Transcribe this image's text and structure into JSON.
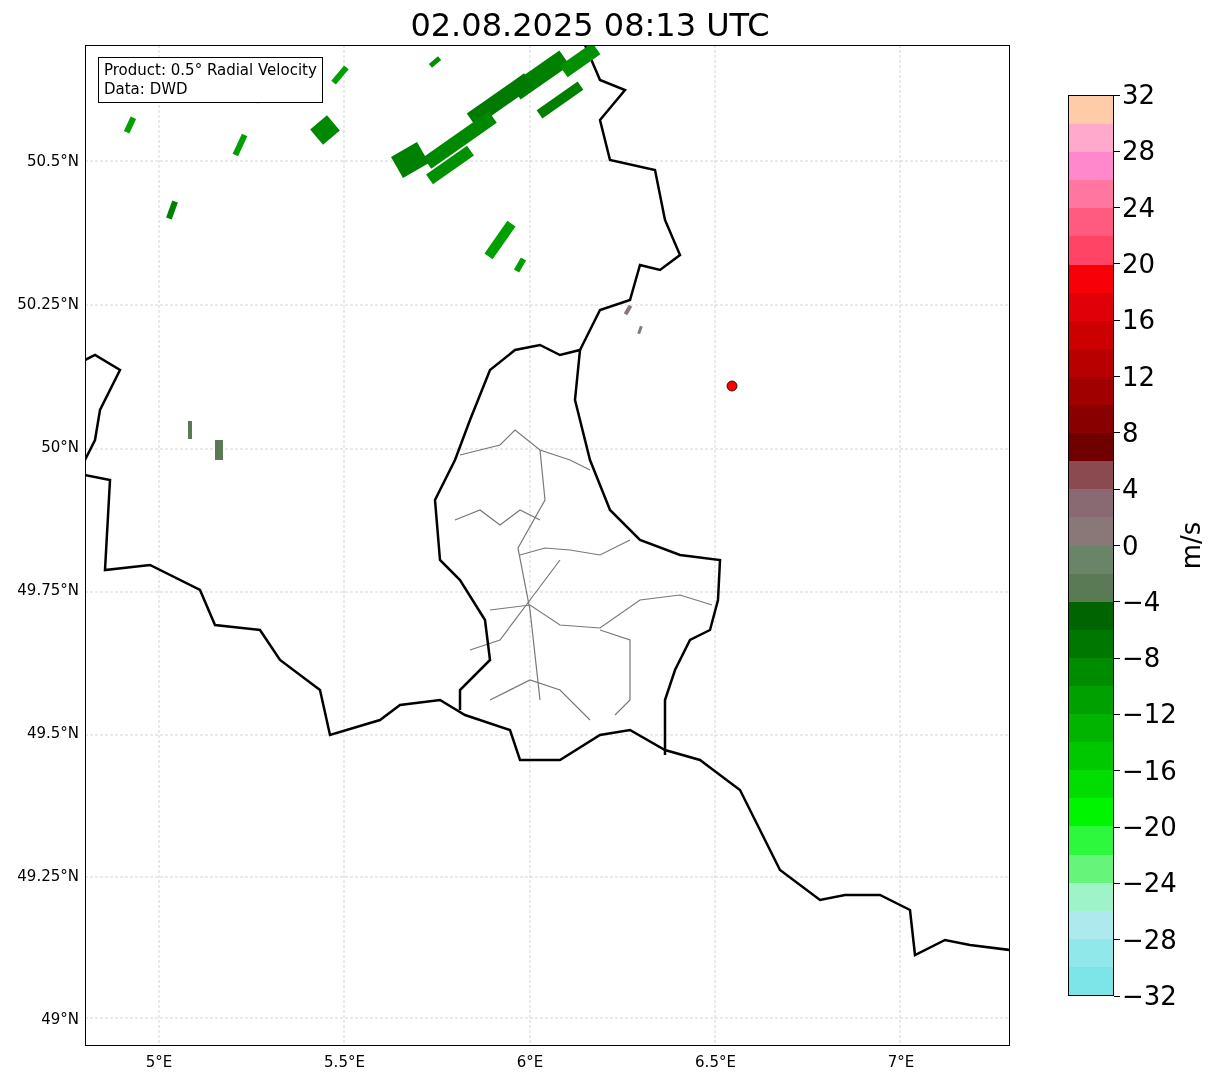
{
  "title": "02.08.2025 08:13 UTC",
  "info_box": {
    "lines": [
      "Product: 0.5° Radial Velocity",
      "Data: DWD"
    ]
  },
  "map": {
    "lat_labels": [
      "50.5°N",
      "50.25°N",
      "50°N",
      "49.75°N",
      "49.5°N",
      "49.25°N",
      "49°N"
    ],
    "lon_labels": [
      "5°E",
      "5.5°E",
      "6°E",
      "6.5°E",
      "7°E"
    ]
  },
  "colorbar": {
    "label": "m/s",
    "ticks": [
      "32",
      "28",
      "24",
      "20",
      "16",
      "12",
      "8",
      "4",
      "0",
      "−4",
      "−8",
      "−12",
      "−16",
      "−20",
      "−24",
      "−28",
      "−32"
    ],
    "bins": [
      {
        "color": "#ffccaa"
      },
      {
        "color": "#ffaacc"
      },
      {
        "color": "#ff88cc"
      },
      {
        "color": "#ff77a0"
      },
      {
        "color": "#ff5a80"
      },
      {
        "color": "#ff4466"
      },
      {
        "color": "#f80008"
      },
      {
        "color": "#e00008"
      },
      {
        "color": "#cc0000"
      },
      {
        "color": "#b80000"
      },
      {
        "color": "#a00000"
      },
      {
        "color": "#880000"
      },
      {
        "color": "#700000"
      },
      {
        "color": "#8a4a50"
      },
      {
        "color": "#8a6a72"
      },
      {
        "color": "#8a7878"
      },
      {
        "color": "#6a8468"
      },
      {
        "color": "#5a7a55"
      },
      {
        "color": "#006400"
      },
      {
        "color": "#007800"
      },
      {
        "color": "#008c00"
      },
      {
        "color": "#00a000"
      },
      {
        "color": "#00b400"
      },
      {
        "color": "#00c800"
      },
      {
        "color": "#00dd00"
      },
      {
        "color": "#00f500"
      },
      {
        "color": "#2ef83e"
      },
      {
        "color": "#66f47a"
      },
      {
        "color": "#9ef3c8"
      },
      {
        "color": "#aee9ee"
      },
      {
        "color": "#90e8ea"
      },
      {
        "color": "#7de5e8"
      }
    ]
  }
}
